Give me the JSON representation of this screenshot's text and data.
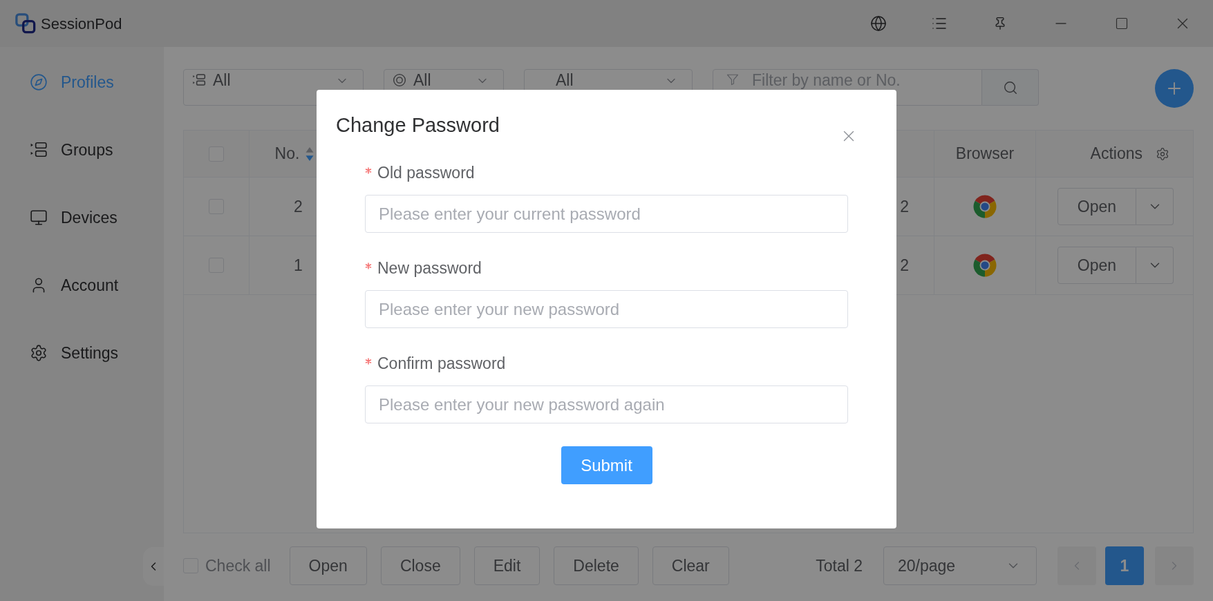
{
  "window": {
    "title": "SessionPod"
  },
  "sidebar": {
    "items": [
      {
        "label": "Profiles",
        "selected": true
      },
      {
        "label": "Groups",
        "selected": false
      },
      {
        "label": "Devices",
        "selected": false
      },
      {
        "label": "Account",
        "selected": false
      },
      {
        "label": "Settings",
        "selected": false
      }
    ]
  },
  "filters": {
    "selects": [
      {
        "value": "All"
      },
      {
        "value": "All"
      },
      {
        "value": "All"
      }
    ],
    "search": {
      "placeholder": "Filter by name or No."
    }
  },
  "table": {
    "header": {
      "checked": false
    },
    "columns": [
      {
        "label": "No.",
        "sort_descending": true
      },
      {
        "label": "Browser"
      },
      {
        "label": "Actions"
      }
    ],
    "rows": [
      {
        "checked": false,
        "no": "2",
        "column_3": "2",
        "action": "Open"
      },
      {
        "checked": false,
        "no": "1",
        "column_3": "2",
        "action": "Open"
      }
    ]
  },
  "footer": {
    "check_all": {
      "label": "Check all",
      "checked": false
    },
    "buttons": [
      "Open",
      "Close",
      "Edit",
      "Delete",
      "Clear"
    ],
    "total": "Total 2",
    "page_size": "20/page",
    "pagination": {
      "prev": {
        "disabled": true
      },
      "pages": [
        {
          "label": "1",
          "selected": true
        }
      ],
      "next": {
        "disabled": true
      }
    }
  },
  "dialog": {
    "title": "Change Password",
    "fields": [
      {
        "label": "Old password",
        "required": true,
        "placeholder": "Please enter your current password"
      },
      {
        "label": "New password",
        "required": true,
        "placeholder": "Please enter your new password"
      },
      {
        "label": "Confirm password",
        "required": true,
        "placeholder": "Please enter your new password again"
      }
    ],
    "submit": "Submit"
  }
}
